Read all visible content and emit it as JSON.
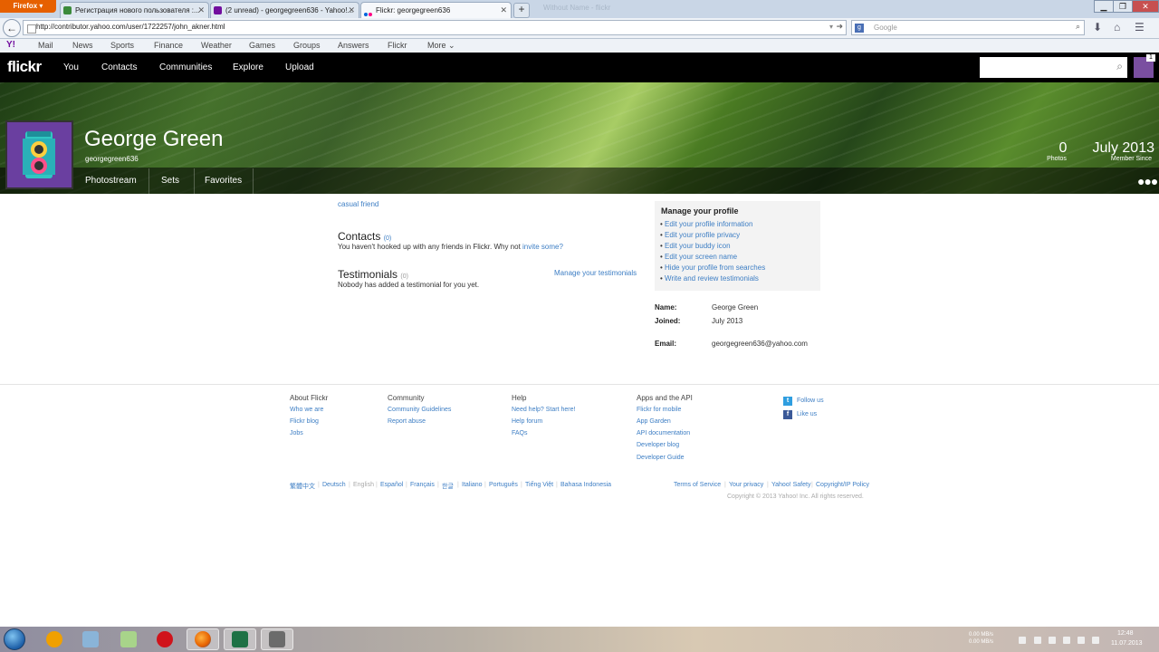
{
  "browser": {
    "app_button": "Firefox",
    "tabs": [
      {
        "label": "Регистрация нового пользователя :...",
        "active": false
      },
      {
        "label": "(2 unread) - georgegreen636 - Yahoo!...",
        "active": false
      },
      {
        "label": "Flickr: georgegreen636",
        "active": true
      }
    ],
    "new_tab": "+",
    "ghost_tab": "Without Name - flickr",
    "url": "http://contributor.yahoo.com/user/1722257/john_akner.html",
    "search_placeholder": "Google",
    "bookmarks": [
      "Mail",
      "News",
      "Sports",
      "Finance",
      "Weather",
      "Games",
      "Groups",
      "Answers",
      "Flickr",
      "More"
    ]
  },
  "flickr_nav": {
    "logo": "flickr",
    "items": [
      "You",
      "Contacts",
      "Communities",
      "Explore",
      "Upload"
    ],
    "notification_count": "1"
  },
  "profile": {
    "name": "George Green",
    "screen_name": "georgegreen636",
    "tabs": [
      "Photostream",
      "Sets",
      "Favorites"
    ],
    "photos_count": "0",
    "photos_label": "Photos",
    "member_since": "July 2013",
    "member_since_label": "Member Since"
  },
  "content": {
    "relation": "casual friend",
    "contacts_title": "Contacts",
    "contacts_count": "(0)",
    "contacts_text": "You haven't hooked up with any friends in Flickr. Why not",
    "contacts_link": "invite some?",
    "testimonials_title": "Testimonials",
    "testimonials_count": "(0)",
    "testimonials_text": "Nobody has added a testimonial for you yet.",
    "manage_testimonials": "Manage your testimonials"
  },
  "manage": {
    "title": "Manage your profile",
    "items": [
      "Edit your profile information",
      "Edit your profile privacy",
      "Edit your buddy icon",
      "Edit your screen name",
      "Hide your profile from searches",
      "Write and review testimonials"
    ]
  },
  "info": {
    "name_label": "Name:",
    "name_value": "George Green",
    "joined_label": "Joined:",
    "joined_value": "July 2013",
    "email_label": "Email:",
    "email_value": "georgegreen636@yahoo.com"
  },
  "footer": {
    "about": {
      "title": "About Flickr",
      "links": [
        "Who we are",
        "Flickr blog",
        "Jobs"
      ]
    },
    "community": {
      "title": "Community",
      "links": [
        "Community Guidelines",
        "Report abuse"
      ]
    },
    "help": {
      "title": "Help",
      "links": [
        "Need help? Start here!",
        "Help forum",
        "FAQs"
      ]
    },
    "apps": {
      "title": "Apps and the API",
      "links": [
        "Flickr for mobile",
        "App Garden",
        "API documentation",
        "Developer blog",
        "Developer Guide"
      ]
    },
    "social": [
      "Follow us",
      "Like us"
    ],
    "languages": [
      "繁體中文",
      "Deutsch",
      "English",
      "Español",
      "Français",
      "한글",
      "Italiano",
      "Português",
      "Tiếng Việt",
      "Bahasa Indonesia"
    ],
    "legal": [
      "Terms of Service",
      "Your privacy",
      "Yahoo! Safety",
      "Copyright/IP Policy"
    ],
    "copyright": "Copyright © 2013 Yahoo! Inc. All rights reserved."
  },
  "taskbar": {
    "net_up": "0.00 MB/s",
    "net_down": "0.00 MB/s",
    "time": "12:48",
    "date": "11.07.2013"
  }
}
